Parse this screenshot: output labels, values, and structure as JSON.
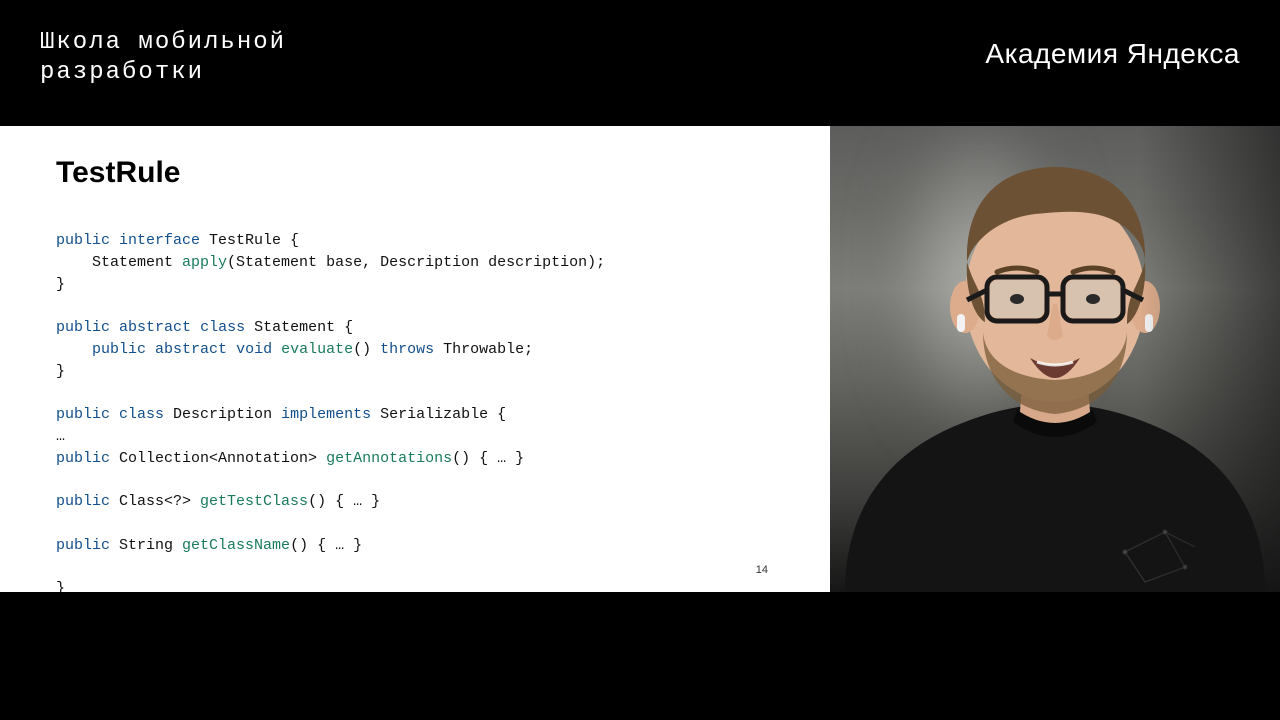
{
  "header": {
    "left_line1": "Школа мобильной",
    "left_line2": "разработки",
    "right": "Академия Яндекса"
  },
  "slide": {
    "title": "TestRule",
    "page_number": "14",
    "code": {
      "l1_a": "public",
      "l1_b": "interface",
      "l1_c": " TestRule {",
      "l2_a": "    Statement ",
      "l2_b": "apply",
      "l2_c": "(Statement base, Description description);",
      "l3": "}",
      "l4": "",
      "l5_a": "public",
      "l5_b": "abstract",
      "l5_c": "class",
      "l5_d": " Statement {",
      "l6_a": "    ",
      "l6_b": "public",
      "l6_c": "abstract",
      "l6_d": "void",
      "l6_e": "evaluate",
      "l6_f": "() ",
      "l6_g": "throws",
      "l6_h": " Throwable;",
      "l7": "}",
      "l8": "",
      "l9_a": "public",
      "l9_b": "class",
      "l9_c": " Description ",
      "l9_d": "implements",
      "l9_e": " Serializable {",
      "l10": "…",
      "l11_a": "public",
      "l11_b": " Collection<Annotation> ",
      "l11_c": "getAnnotations",
      "l11_d": "() { … }",
      "l12": "",
      "l13_a": "public",
      "l13_b": " Class<?> ",
      "l13_c": "getTestClass",
      "l13_d": "() { … }",
      "l14": "",
      "l15_a": "public",
      "l15_b": " String ",
      "l15_c": "getClassName",
      "l15_d": "() { … }",
      "l16": "",
      "l17": "}"
    }
  }
}
